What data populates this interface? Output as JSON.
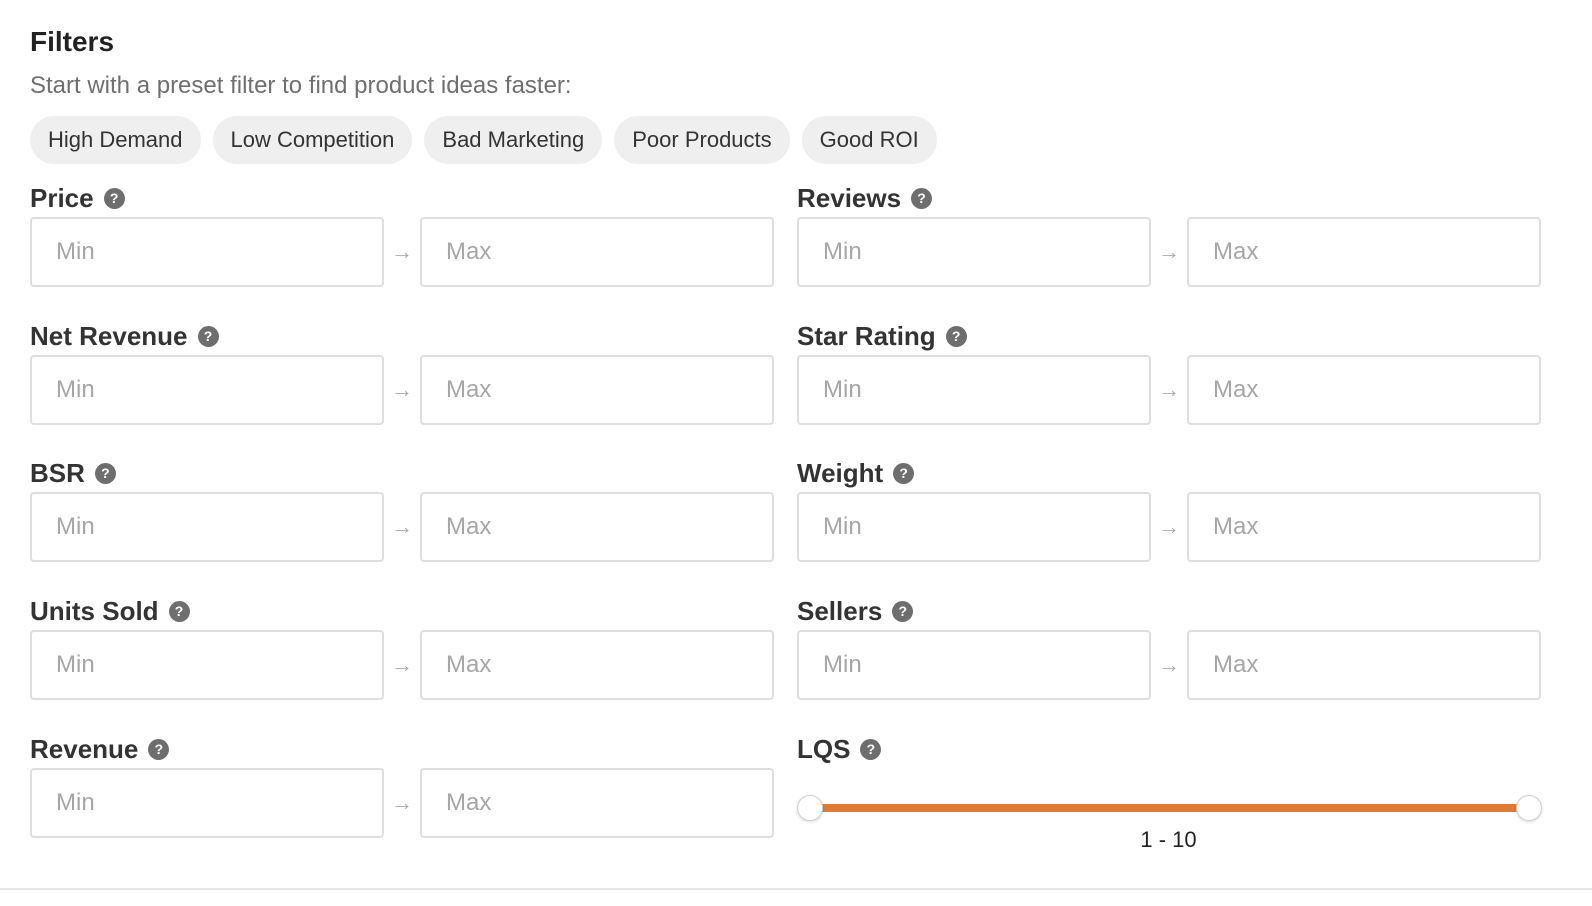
{
  "header": {
    "title": "Filters",
    "subtitle": "Start with a preset filter to find product ideas faster:"
  },
  "presets": [
    "High Demand",
    "Low Competition",
    "Bad Marketing",
    "Poor Products",
    "Good ROI"
  ],
  "filters": {
    "left": [
      {
        "label": "Price",
        "min_placeholder": "Min",
        "max_placeholder": "Max"
      },
      {
        "label": "Net Revenue",
        "min_placeholder": "Min",
        "max_placeholder": "Max"
      },
      {
        "label": "BSR",
        "min_placeholder": "Min",
        "max_placeholder": "Max"
      },
      {
        "label": "Units Sold",
        "min_placeholder": "Min",
        "max_placeholder": "Max"
      },
      {
        "label": "Revenue",
        "min_placeholder": "Min",
        "max_placeholder": "Max"
      }
    ],
    "right": [
      {
        "label": "Reviews",
        "min_placeholder": "Min",
        "max_placeholder": "Max"
      },
      {
        "label": "Star Rating",
        "min_placeholder": "Min",
        "max_placeholder": "Max"
      },
      {
        "label": "Weight",
        "min_placeholder": "Min",
        "max_placeholder": "Max"
      },
      {
        "label": "Sellers",
        "min_placeholder": "Min",
        "max_placeholder": "Max"
      }
    ]
  },
  "lqs": {
    "label": "LQS",
    "min": 1,
    "max": 10,
    "value_low": 1,
    "value_high": 10,
    "range_text": "1  -  10",
    "accent_color": "#e07b35"
  },
  "icons": {
    "help": "question-circle-icon",
    "help_glyph": "?",
    "arrow": "arrow-right-icon",
    "arrow_glyph": "→"
  }
}
